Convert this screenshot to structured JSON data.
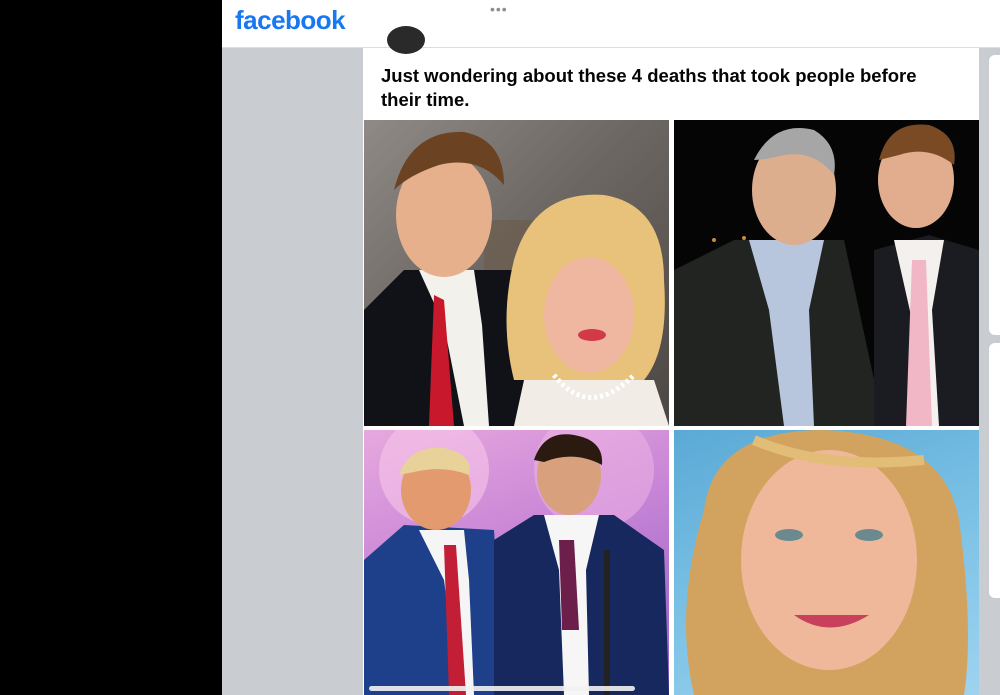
{
  "app": {
    "logo_text": "facebook",
    "brand_color": "#1877f2",
    "more_icon": "more-horizontal-icon"
  },
  "post": {
    "text": "Just wondering about these 4 deaths that took people before their time.",
    "photos": [
      {
        "id": "photo-1"
      },
      {
        "id": "photo-2"
      },
      {
        "id": "photo-3"
      },
      {
        "id": "photo-4"
      }
    ]
  }
}
